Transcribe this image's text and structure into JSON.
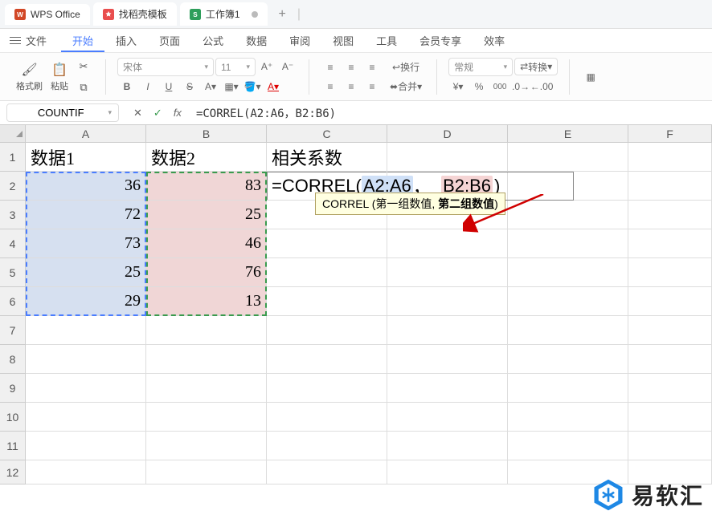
{
  "titlebar": {
    "app_name": "WPS Office",
    "tab_template": "找稻壳模板",
    "workbook": "工作簿1",
    "plus": "+",
    "sep": "|"
  },
  "menu": {
    "file": "文件",
    "items": [
      "开始",
      "插入",
      "页面",
      "公式",
      "数据",
      "审阅",
      "视图",
      "工具",
      "会员专享",
      "效率"
    ],
    "active_index": 0
  },
  "toolbar": {
    "format_brush": "格式刷",
    "paste": "粘贴",
    "font_name": "宋体",
    "font_size": "11",
    "wrap": "换行",
    "merge": "合并",
    "general": "常规",
    "convert": "转换"
  },
  "formula_bar": {
    "name_box": "COUNTIF",
    "cancel": "✕",
    "confirm": "✓",
    "fx": "fx",
    "formula_raw": "=CORREL(A2:A6，B2:B6)"
  },
  "sheet": {
    "columns": [
      "A",
      "B",
      "C",
      "D",
      "E",
      "F"
    ],
    "rows": [
      "1",
      "2",
      "3",
      "4",
      "5",
      "6",
      "7",
      "8",
      "9",
      "10",
      "11",
      "12"
    ],
    "headers": {
      "A1": "数据1",
      "B1": "数据2",
      "C1": "相关系数"
    },
    "dataA": [
      "36",
      "72",
      "73",
      "25",
      "29"
    ],
    "dataB": [
      "83",
      "25",
      "46",
      "76",
      "13"
    ],
    "c2_display": {
      "pre": "=CORREL(",
      "arg1": "A2:A6",
      "comma": "，",
      "arg2": "B2:B6",
      "post": ")"
    },
    "hint": {
      "fn": "CORREL ",
      "open": "(",
      "p1": "第一组数值, ",
      "p2": "第二组数值",
      "close": ")"
    }
  },
  "watermark": {
    "text": "易软汇"
  },
  "colors": {
    "accent": "#4a7dff",
    "sel_blue": "#d6e0f0",
    "sel_pink": "#f0d6d6",
    "marquee_green": "#3a9b4e",
    "hint_bg": "#ffffe1"
  }
}
